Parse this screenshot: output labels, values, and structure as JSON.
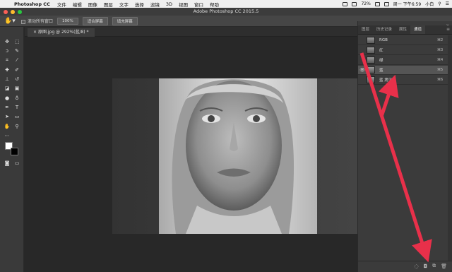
{
  "menubar": {
    "app": "Photoshop CC",
    "items": [
      "文件",
      "编辑",
      "图像",
      "图层",
      "文字",
      "选择",
      "滤镜",
      "3D",
      "视图",
      "窗口",
      "帮助"
    ],
    "battery": "72%",
    "time": "周一 下午6:59",
    "user": "小白"
  },
  "window": {
    "title": "Adobe Photoshop CC 2015.5"
  },
  "options": {
    "scroll_all": "滚动所有窗口",
    "zoom": "100%",
    "fit": "适合屏幕",
    "fill": "填充屏幕"
  },
  "doc": {
    "tab": "原图.jpg @ 292%(蓝/8) *"
  },
  "panel": {
    "tabs": [
      "图层",
      "历史记录",
      "属性",
      "通道"
    ],
    "active_tab": "通道",
    "channels": [
      {
        "name": "RGB",
        "shortcut": "⌘2"
      },
      {
        "name": "红",
        "shortcut": "⌘3"
      },
      {
        "name": "绿",
        "shortcut": "⌘4"
      },
      {
        "name": "蓝",
        "shortcut": "⌘5"
      },
      {
        "name": "蓝 拷贝",
        "shortcut": "⌘6"
      }
    ]
  },
  "colors": {
    "arrow": "#e8304a",
    "menubar": "#efefef",
    "panel": "#3b3b3b"
  }
}
